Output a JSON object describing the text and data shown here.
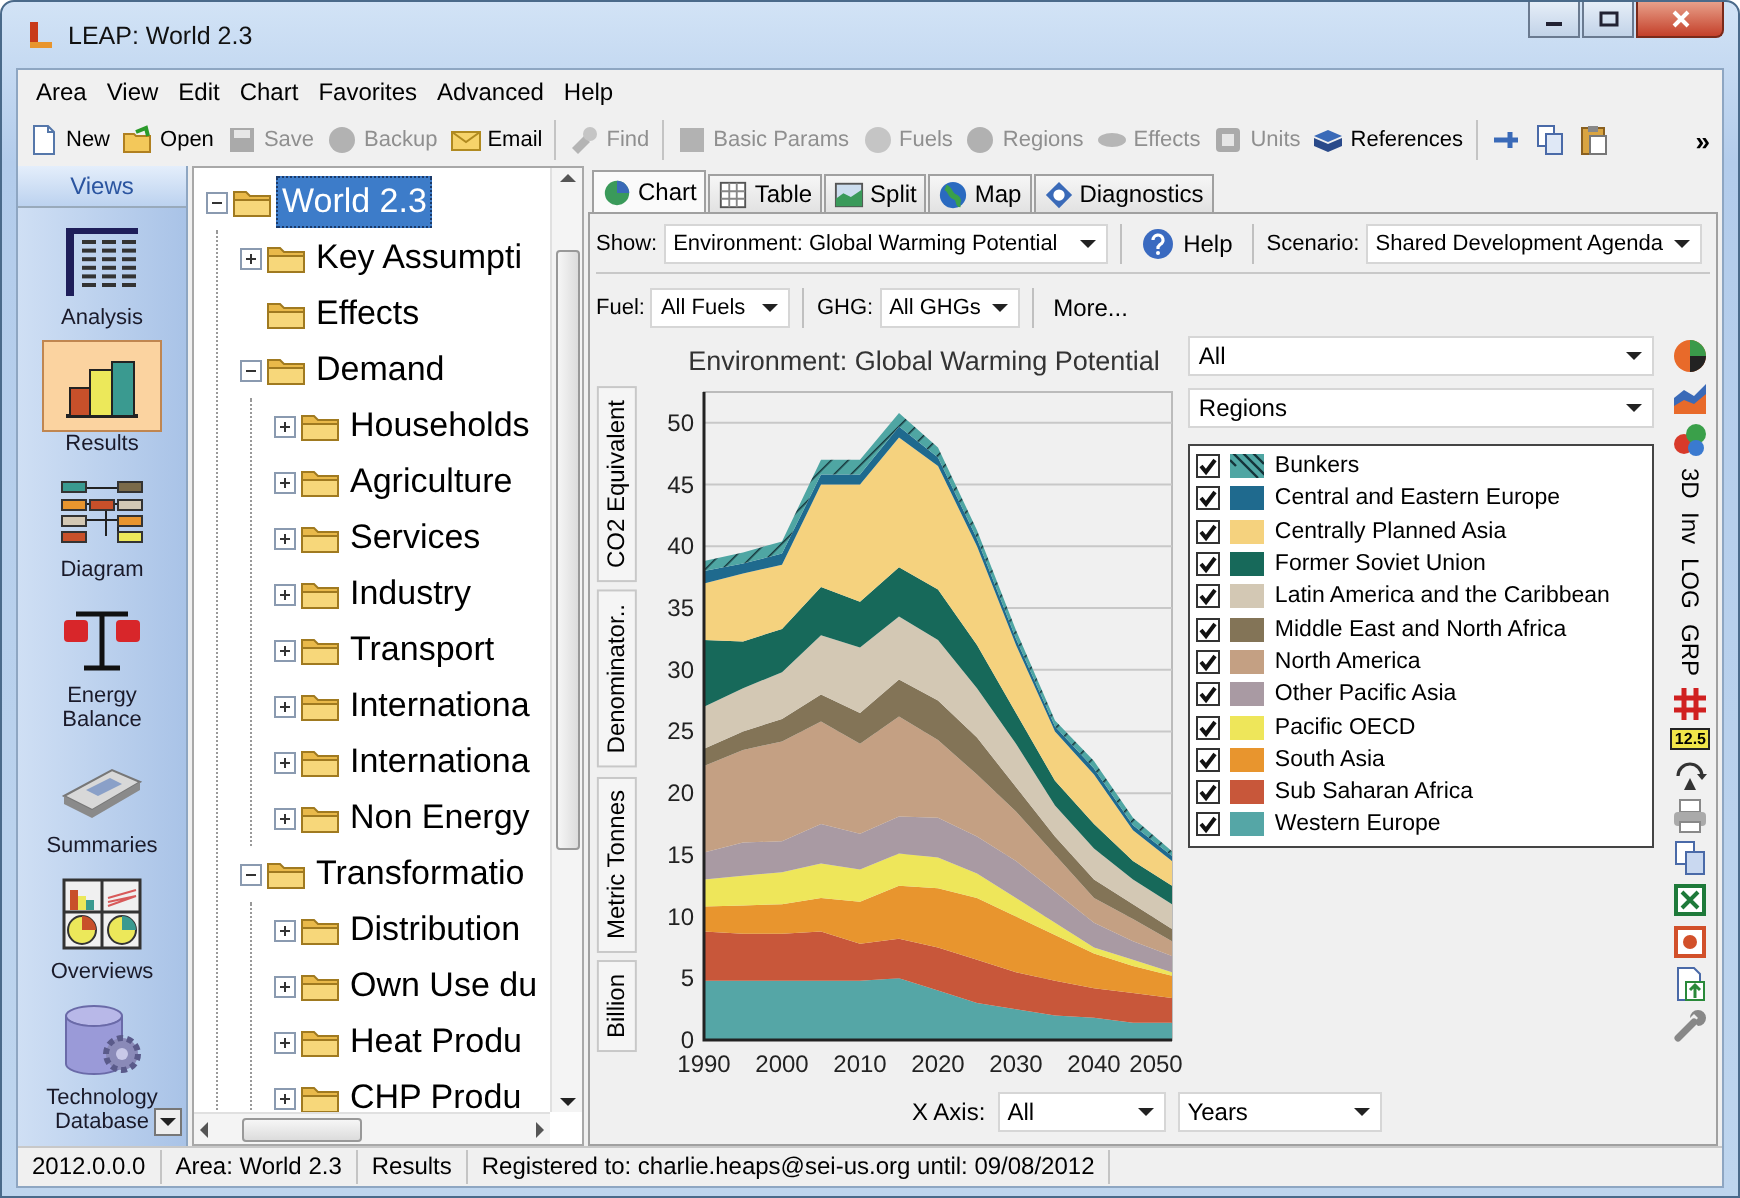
{
  "window": {
    "title": "LEAP: World 2.3"
  },
  "menu": [
    "Area",
    "View",
    "Edit",
    "Chart",
    "Favorites",
    "Advanced",
    "Help"
  ],
  "toolbar": [
    {
      "items": [
        {
          "kind": "new",
          "label": "New",
          "disabled": false
        },
        {
          "kind": "open",
          "label": "Open",
          "disabled": false
        },
        {
          "kind": "save",
          "label": "Save",
          "disabled": true
        },
        {
          "kind": "backup",
          "label": "Backup",
          "disabled": true
        },
        {
          "kind": "email",
          "label": "Email",
          "disabled": false
        }
      ]
    },
    {
      "items": [
        {
          "kind": "find",
          "label": "Find",
          "disabled": true
        }
      ]
    },
    {
      "items": [
        {
          "kind": "params",
          "label": "Basic Params",
          "disabled": true
        },
        {
          "kind": "fuels",
          "label": "Fuels",
          "disabled": true
        },
        {
          "kind": "regions",
          "label": "Regions",
          "disabled": true
        },
        {
          "kind": "effects",
          "label": "Effects",
          "disabled": true
        },
        {
          "kind": "units",
          "label": "Units",
          "disabled": true
        },
        {
          "kind": "references",
          "label": "References",
          "disabled": false
        }
      ]
    },
    {
      "items": [
        {
          "kind": "pin",
          "disabled": false
        },
        {
          "kind": "copy",
          "disabled": false
        },
        {
          "kind": "paste",
          "disabled": false
        }
      ]
    }
  ],
  "toolbar_more": "»",
  "views": {
    "title": "Views",
    "items": [
      {
        "kind": "analysis",
        "label": "Analysis",
        "selected": false
      },
      {
        "kind": "results",
        "label": "Results",
        "selected": true
      },
      {
        "kind": "diagram",
        "label": "Diagram",
        "selected": false
      },
      {
        "kind": "balance",
        "label": "Energy Balance",
        "selected": false
      },
      {
        "kind": "summaries",
        "label": "Summaries",
        "selected": false
      },
      {
        "kind": "overviews",
        "label": "Overviews",
        "selected": false
      },
      {
        "kind": "database",
        "label": "Technology Database",
        "selected": false
      }
    ]
  },
  "tree": {
    "nodes": [
      {
        "label": "World 2.3",
        "selected": true,
        "expanded": true,
        "children": [
          {
            "label": "Key Assumpti",
            "selected": false,
            "expanded": false
          },
          {
            "label": "Effects",
            "selected": false
          },
          {
            "label": "Demand",
            "selected": false,
            "expanded": true,
            "children": [
              {
                "label": "Households",
                "selected": false,
                "expanded": false
              },
              {
                "label": "Agriculture",
                "selected": false,
                "expanded": false
              },
              {
                "label": "Services",
                "selected": false,
                "expanded": false
              },
              {
                "label": "Industry",
                "selected": false,
                "expanded": false
              },
              {
                "label": "Transport",
                "selected": false,
                "expanded": false
              },
              {
                "label": "Internationa",
                "selected": false,
                "expanded": false
              },
              {
                "label": "Internationa",
                "selected": false,
                "expanded": false
              },
              {
                "label": "Non Energy",
                "selected": false,
                "expanded": false
              }
            ]
          },
          {
            "label": "Transformatio",
            "selected": false,
            "expanded": true,
            "children": [
              {
                "label": "Distribution",
                "selected": false,
                "expanded": false
              },
              {
                "label": "Own Use du",
                "selected": false,
                "expanded": false
              },
              {
                "label": "Heat Produ",
                "selected": false,
                "expanded": false
              },
              {
                "label": "CHP Produ",
                "selected": false,
                "expanded": false
              }
            ]
          }
        ]
      }
    ]
  },
  "chart_tabs": [
    {
      "kind": "chart",
      "label": "Chart",
      "selected": true
    },
    {
      "kind": "table",
      "label": "Table",
      "selected": false
    },
    {
      "kind": "split",
      "label": "Split",
      "selected": false
    },
    {
      "kind": "map",
      "label": "Map",
      "selected": false
    },
    {
      "kind": "diagnostics",
      "label": "Diagnostics",
      "selected": false
    }
  ],
  "show": {
    "label": "Show:",
    "value": "Environment: Global Warming Potential"
  },
  "help": "Help",
  "scenario": {
    "label": "Scenario:",
    "value": "Shared Development Agenda"
  },
  "filters": [
    {
      "label": "Fuel:",
      "value": "All Fuels"
    },
    {
      "label": "GHG:",
      "value": "All GHGs"
    }
  ],
  "more": "More...",
  "chart": {
    "axis_buttons": [
      "CO2 Equivalent",
      "Denominator..",
      "Metric Tonnes",
      "Billion"
    ],
    "series_filter": "All",
    "group_by": "Regions",
    "legend": [
      {
        "checked": true,
        "hatched": true
      },
      {
        "checked": true,
        "hatched": false
      },
      {
        "checked": true,
        "hatched": false
      },
      {
        "checked": true,
        "hatched": false
      },
      {
        "checked": true,
        "hatched": false
      },
      {
        "checked": true,
        "hatched": false
      },
      {
        "checked": true,
        "hatched": false
      },
      {
        "checked": true,
        "hatched": false
      },
      {
        "checked": true,
        "hatched": false
      },
      {
        "checked": true,
        "hatched": false
      },
      {
        "checked": true,
        "hatched": false
      },
      {
        "checked": true,
        "hatched": false
      }
    ],
    "chart_data": {
      "type": "area",
      "title": "Environment: Global Warming Potential",
      "stacked": true,
      "grid": true,
      "x": [
        1990,
        1995,
        2000,
        2005,
        2010,
        2015,
        2020,
        2025,
        2030,
        2035,
        2040,
        2045,
        2050
      ],
      "xlim": [
        1990,
        2050
      ],
      "ylim": [
        0,
        52.5
      ],
      "xticks": [
        1990,
        2000,
        2010,
        2020,
        2030,
        2040,
        2050
      ],
      "yticks": [
        0,
        5,
        10,
        15,
        20,
        25,
        30,
        35,
        40,
        45,
        50
      ],
      "series": [
        {
          "name": "Bunkers",
          "color": "#4fa6a3",
          "values": [
            0.8,
            0.9,
            1,
            1.2,
            1.2,
            1.1,
            0.8,
            0.7,
            0.7,
            0.5,
            0.6,
            0.6,
            0.4
          ]
        },
        {
          "name": "Central and Eastern Europe",
          "color": "#1f6a8e",
          "values": [
            1,
            0.8,
            0.9,
            0.8,
            0.8,
            0.9,
            0.7,
            0.6,
            0.5,
            0.4,
            0.5,
            0.4,
            0.4
          ]
        },
        {
          "name": "Centrally Planned Asia",
          "color": "#f5d27e",
          "values": [
            4.6,
            5.5,
            5.2,
            8.3,
            9.5,
            10.5,
            10,
            8,
            5.5,
            4,
            4,
            2.5,
            2
          ]
        },
        {
          "name": "Former Soviet Union",
          "color": "#17695a",
          "values": [
            5.4,
            3.8,
            3.5,
            3.9,
            3.7,
            4,
            4.1,
            3.5,
            2.5,
            2,
            2,
            1.5,
            1.5
          ]
        },
        {
          "name": "Latin America and the Caribbean",
          "color": "#d3c8b4",
          "values": [
            3.4,
            3.5,
            3.8,
            4.8,
            5.3,
            5.1,
            4.9,
            4,
            3.5,
            2.5,
            2.5,
            2,
            2
          ]
        },
        {
          "name": "Middle East and North Africa",
          "color": "#837457",
          "values": [
            1.4,
            1.5,
            1.8,
            2.2,
            2.5,
            3,
            3.2,
            3,
            2,
            1.5,
            1.5,
            1.2,
            1
          ]
        },
        {
          "name": "North America",
          "color": "#c4a083",
          "values": [
            7,
            7.5,
            8.1,
            8.3,
            7.3,
            8.1,
            6.3,
            5,
            4,
            3,
            2,
            1.8,
            1.2
          ]
        },
        {
          "name": "Other Pacific Asia",
          "color": "#a99aa3",
          "values": [
            2.2,
            2.7,
            2.5,
            3.2,
            2.9,
            3,
            3.2,
            3,
            3,
            2.5,
            2,
            1.5,
            1.3
          ]
        },
        {
          "name": "Pacific OECD",
          "color": "#eee65a",
          "values": [
            2.2,
            2.4,
            2.6,
            2.8,
            2.6,
            2.6,
            2.5,
            2,
            1.5,
            1,
            0.5,
            0.5,
            0.3
          ]
        },
        {
          "name": "South Asia",
          "color": "#e8952e",
          "values": [
            2,
            2.3,
            2.4,
            2.7,
            3.4,
            4.3,
            4.8,
            5,
            4.5,
            3.7,
            2.8,
            2.2,
            1.8
          ]
        },
        {
          "name": "Sub Saharan Africa",
          "color": "#c8573a",
          "values": [
            4,
            3.8,
            3.8,
            4,
            3,
            3.2,
            3.5,
            3.5,
            3,
            2.8,
            2.4,
            2.4,
            2
          ]
        },
        {
          "name": "Western Europe",
          "color": "#55a6a6",
          "values": [
            4.8,
            4.8,
            4.8,
            4.8,
            4.8,
            5,
            4,
            3,
            2.5,
            2,
            1.8,
            1.4,
            1.4
          ]
        }
      ]
    }
  },
  "side_tools": [
    {
      "kind": "pie"
    },
    {
      "kind": "area"
    },
    {
      "kind": "bubbles"
    },
    {
      "kind": "toggle",
      "label": "3D"
    },
    {
      "kind": "toggle",
      "label": "Inv"
    },
    {
      "kind": "toggle",
      "label": "LOG"
    },
    {
      "kind": "toggle",
      "label": "GRP"
    },
    {
      "kind": "grid"
    },
    {
      "kind": "badge",
      "label": "12.5"
    },
    {
      "kind": "rotate"
    },
    {
      "kind": "print"
    },
    {
      "kind": "copy"
    },
    {
      "kind": "excel"
    },
    {
      "kind": "powerpoint"
    },
    {
      "kind": "export"
    },
    {
      "kind": "wrench"
    }
  ],
  "x_axis": {
    "label": "X Axis:",
    "value": "All",
    "unit": "Years"
  },
  "status_bar": [
    "2012.0.0.0",
    "Area: World 2.3",
    "Results",
    "Registered to: charlie.heaps@sei-us.org until: 09/08/2012"
  ]
}
